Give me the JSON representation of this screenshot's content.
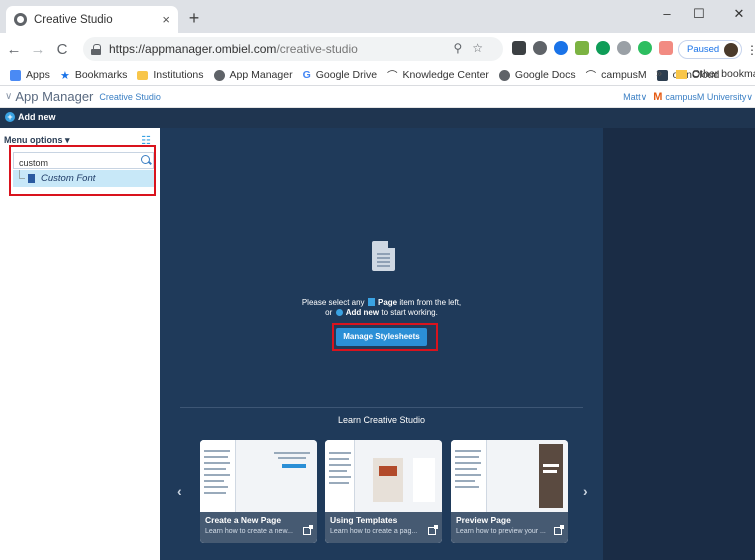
{
  "browser": {
    "tab_title": "Creative Studio",
    "tab_close": "×",
    "new_tab": "+",
    "win_min": "–",
    "win_max": "☐",
    "win_close": "✕",
    "back": "←",
    "forward": "→",
    "reload": "C",
    "url_host": "https://appmanager.ombiel.com",
    "url_path": "/creative-studio",
    "url_icons": "⚲☆",
    "paused_label": "Paused",
    "menu": "⋮"
  },
  "bookmarks": {
    "items": [
      "Apps",
      "Bookmarks",
      "Institutions",
      "App Manager",
      "Google Drive",
      "Knowledge Center",
      "Google Docs",
      "campusM",
      "ownCloud"
    ],
    "overflow": "»",
    "other": "Other bookmarks"
  },
  "app": {
    "title_chevron": "∨",
    "title": "App Manager",
    "subtitle": "Creative Studio",
    "user": "Matt",
    "user_chevron": "∨",
    "org_logo": "M",
    "org": "campusM University",
    "org_chevron": "∨",
    "add_new": "Add new"
  },
  "sidebar": {
    "menu_label": "Menu options ▾",
    "search_value": "custom",
    "search_placeholder": "",
    "items": [
      {
        "label": "Custom Font"
      }
    ]
  },
  "main": {
    "message_pre": "Please select any",
    "message_page": "Page",
    "message_mid": "item from the left,",
    "message_or": "or",
    "message_add": "Add new",
    "message_end": "to start working.",
    "manage_button": "Manage Stylesheets",
    "learn_title": "Learn Creative Studio",
    "prev_arrow": "‹",
    "next_arrow": "›",
    "cards": [
      {
        "title": "Create a New Page",
        "desc": "Learn how to create a new..."
      },
      {
        "title": "Using Templates",
        "desc": "Learn how to create a pag..."
      },
      {
        "title": "Preview Page",
        "desc": "Learn how to preview your ..."
      }
    ]
  },
  "colors": {
    "accent": "#2b8fd6",
    "dark_bg": "#1a2c45",
    "panel_bg": "#1f3a5a",
    "highlight": "#d9131d"
  }
}
